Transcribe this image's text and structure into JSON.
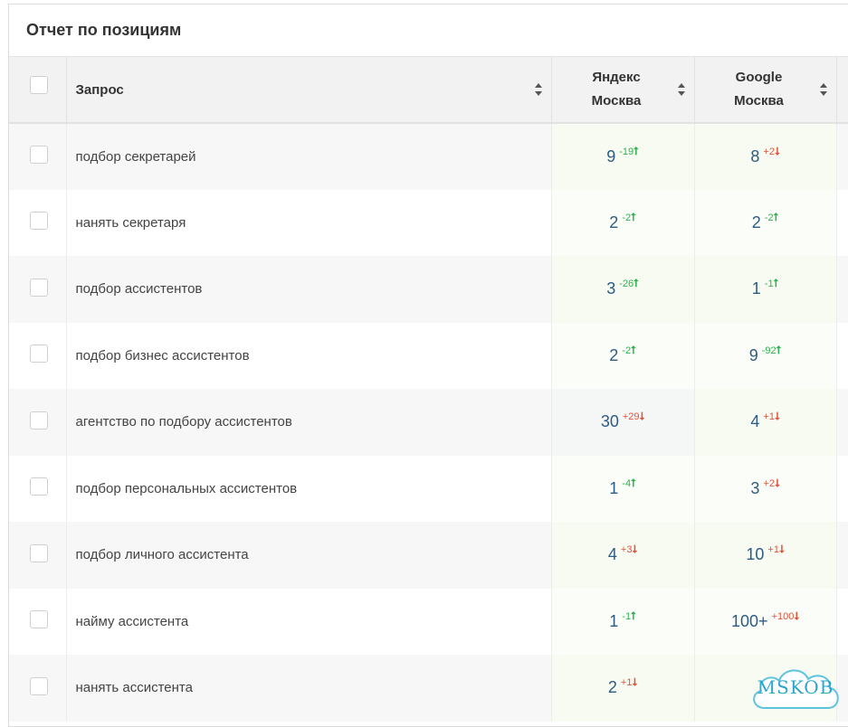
{
  "panel": {
    "title": "Отчет по позициям"
  },
  "table": {
    "headers": {
      "query": "Запрос",
      "yandex": {
        "line1": "Яндекс",
        "line2": "Москва"
      },
      "google": {
        "line1": "Google",
        "line2": "Москва"
      }
    },
    "rows": [
      {
        "query": "подбор секретарей",
        "yandex": {
          "pos": "9",
          "delta": "-19",
          "arrow": "⭡"
        },
        "google": {
          "pos": "8",
          "delta": "+2",
          "arrow": "⭣"
        }
      },
      {
        "query": "нанять секретаря",
        "yandex": {
          "pos": "2",
          "delta": "-2",
          "arrow": "⭡"
        },
        "google": {
          "pos": "2",
          "delta": "-2",
          "arrow": "⭡"
        }
      },
      {
        "query": "подбор ассистентов",
        "yandex": {
          "pos": "3",
          "delta": "-26",
          "arrow": "⭡"
        },
        "google": {
          "pos": "1",
          "delta": "-1",
          "arrow": "⭡"
        }
      },
      {
        "query": "подбор бизнес ассистентов",
        "yandex": {
          "pos": "2",
          "delta": "-2",
          "arrow": "⭡"
        },
        "google": {
          "pos": "9",
          "delta": "-92",
          "arrow": "⭡"
        }
      },
      {
        "query": "агентство по подбору ассистентов",
        "yandex": {
          "pos": "30",
          "delta": "+29",
          "arrow": "⭣"
        },
        "google": {
          "pos": "4",
          "delta": "+1",
          "arrow": "⭣"
        }
      },
      {
        "query": "подбор персональных ассистентов",
        "yandex": {
          "pos": "1",
          "delta": "-4",
          "arrow": "⭡"
        },
        "google": {
          "pos": "3",
          "delta": "+2",
          "arrow": "⭣"
        }
      },
      {
        "query": "подбор личного ассистента",
        "yandex": {
          "pos": "4",
          "delta": "+3",
          "arrow": "⭣"
        },
        "google": {
          "pos": "10",
          "delta": "+1",
          "arrow": "⭣"
        }
      },
      {
        "query": "найму ассистента",
        "yandex": {
          "pos": "1",
          "delta": "-1",
          "arrow": "⭡"
        },
        "google": {
          "pos": "100+",
          "delta": "+100",
          "arrow": "⭣"
        }
      },
      {
        "query": "нанять ассистента",
        "yandex": {
          "pos": "2",
          "delta": "+1",
          "arrow": "⭣"
        },
        "google": {
          "pos": "",
          "delta": "",
          "arrow": ""
        }
      }
    ]
  },
  "watermark": {
    "text": "MSKOB"
  },
  "colors": {
    "up": "#2bb24c",
    "down": "#e0533a",
    "position": "#2d5b84",
    "watermark": "#2aa7c9"
  }
}
